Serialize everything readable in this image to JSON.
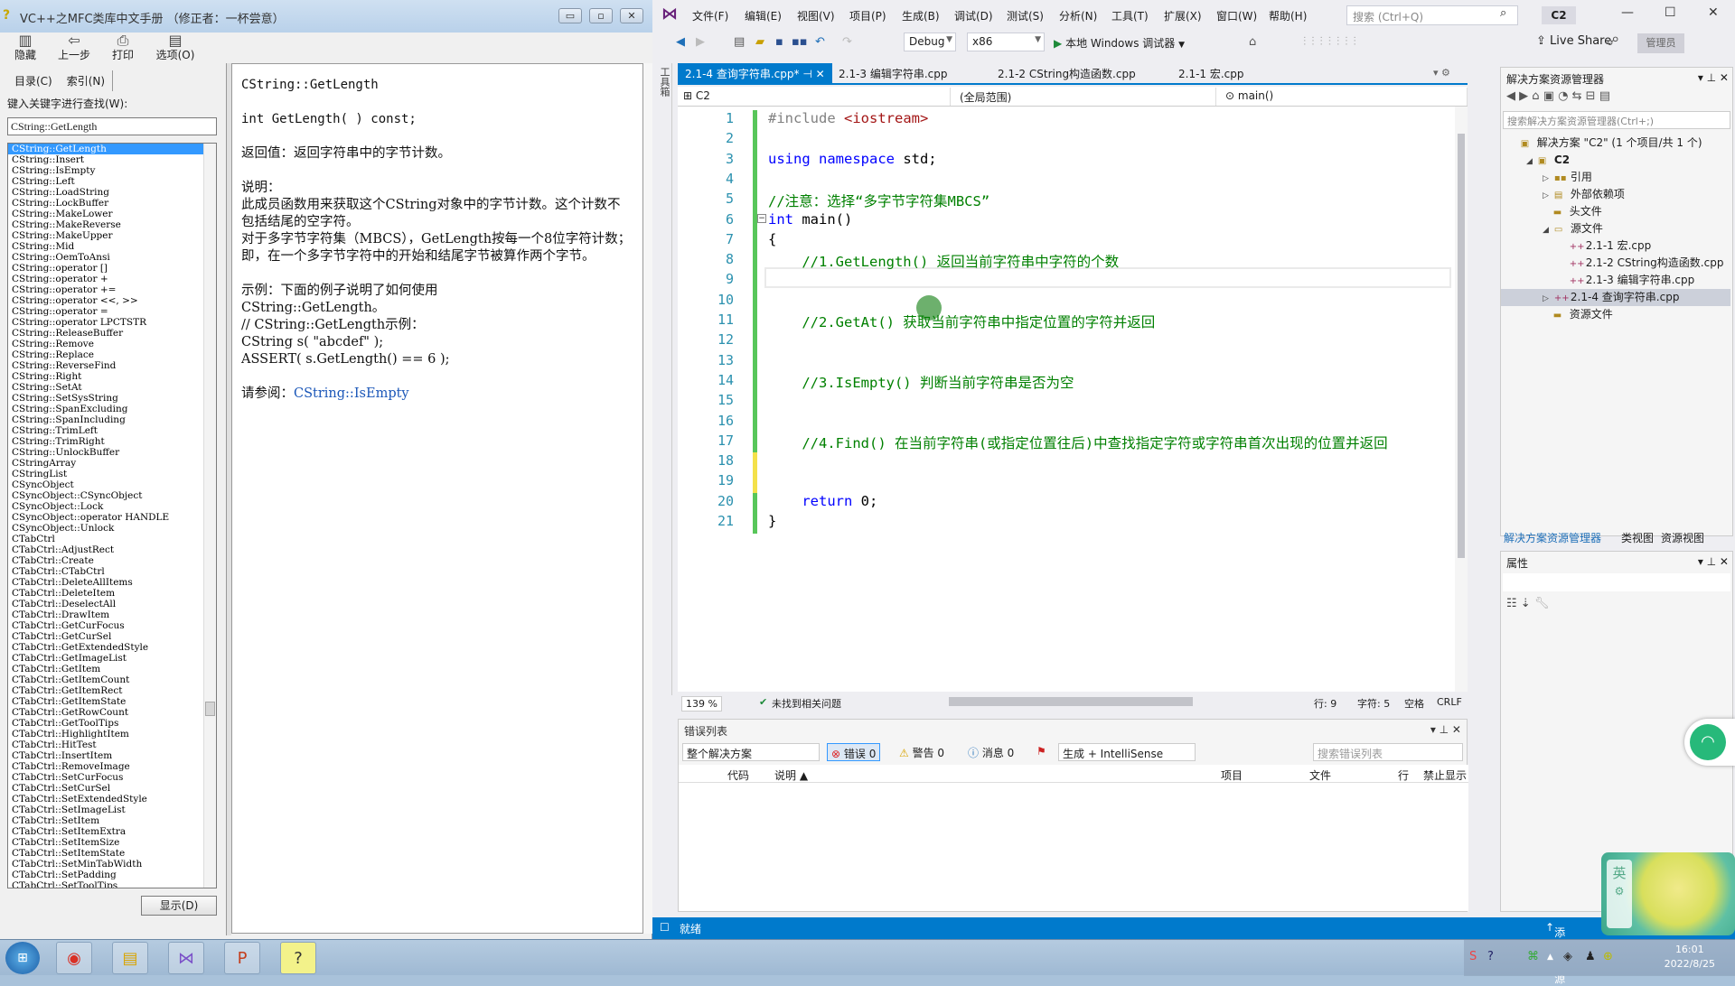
{
  "help_window": {
    "title": "VC++之MFC类库中文手册 （修正者：一杯尝意）",
    "window_controls": {
      "minimize": "▭",
      "restore": "▫",
      "close": "✕"
    },
    "toolbar": [
      {
        "icon": "hide-icon",
        "glyph": "▥",
        "label": "隐藏"
      },
      {
        "icon": "back-arrow-icon",
        "glyph": "⇦",
        "label": "上一步"
      },
      {
        "icon": "print-icon",
        "glyph": "⎙",
        "label": "打印"
      },
      {
        "icon": "options-icon",
        "glyph": "▤",
        "label": "选项(O)"
      }
    ],
    "tabs": [
      {
        "label": "目录(C)"
      },
      {
        "label": "索引(N)"
      }
    ],
    "keyword_label": "键入关键字进行查找(W):",
    "keyword_value": "CString::GetLength",
    "index_items": [
      "CString::GetLength",
      "CString::Insert",
      "CString::IsEmpty",
      "CString::Left",
      "CString::LoadString",
      "CString::LockBuffer",
      "CString::MakeLower",
      "CString::MakeReverse",
      "CString::MakeUpper",
      "CString::Mid",
      "CString::OemToAnsi",
      "CString::operator []",
      "CString::operator +",
      "CString::operator +=",
      "CString::operator <<, >>",
      "CString::operator =",
      "CString::operator LPCTSTR",
      "CString::ReleaseBuffer",
      "CString::Remove",
      "CString::Replace",
      "CString::ReverseFind",
      "CString::Right",
      "CString::SetAt",
      "CString::SetSysString",
      "CString::SpanExcluding",
      "CString::SpanIncluding",
      "CString::TrimLeft",
      "CString::TrimRight",
      "CString::UnlockBuffer",
      "CStringArray",
      "CStringList",
      "CSyncObject",
      "CSyncObject::CSyncObject",
      "CSyncObject::Lock",
      "CSyncObject::operator HANDLE",
      "CSyncObject::Unlock",
      "CTabCtrl",
      "CTabCtrl::AdjustRect",
      "CTabCtrl::Create",
      "CTabCtrl::CTabCtrl",
      "CTabCtrl::DeleteAllItems",
      "CTabCtrl::DeleteItem",
      "CTabCtrl::DeselectAll",
      "CTabCtrl::DrawItem",
      "CTabCtrl::GetCurFocus",
      "CTabCtrl::GetCurSel",
      "CTabCtrl::GetExtendedStyle",
      "CTabCtrl::GetImageList",
      "CTabCtrl::GetItem",
      "CTabCtrl::GetItemCount",
      "CTabCtrl::GetItemRect",
      "CTabCtrl::GetItemState",
      "CTabCtrl::GetRowCount",
      "CTabCtrl::GetToolTips",
      "CTabCtrl::HighlightItem",
      "CTabCtrl::HitTest",
      "CTabCtrl::InsertItem",
      "CTabCtrl::RemoveImage",
      "CTabCtrl::SetCurFocus",
      "CTabCtrl::SetCurSel",
      "CTabCtrl::SetExtendedStyle",
      "CTabCtrl::SetImageList",
      "CTabCtrl::SetItem",
      "CTabCtrl::SetItemExtra",
      "CTabCtrl::SetItemSize",
      "CTabCtrl::SetItemState",
      "CTabCtrl::SetMinTabWidth",
      "CTabCtrl::SetPadding",
      "CTabCtrl::SetToolTips"
    ],
    "selected_index": 0,
    "show_button": "显示(D)",
    "article": {
      "title": "CString::GetLength",
      "signature": "int GetLength( ) const;",
      "return_value": "返回值：返回字符串中的字节计数。",
      "remarks_heading": "说明：",
      "remarks_1": "此成员函数用来获取这个CString对象中的字节计数。这个计数不包括结尾的空字符。",
      "remarks_2": "对于多字节字符集（MBCS），GetLength按每一个8位字符计数；即，在一个多字节字符中的开始和结尾字节被算作两个字节。",
      "example_heading": "示例：下面的例子说明了如何使用",
      "example_1": "CString::GetLength。",
      "example_2": "// CString::GetLength示例：",
      "example_3": "CString s( \"abcdef\" );",
      "example_4": "ASSERT( s.GetLength() == 6 );",
      "see_also_label": "请参阅：",
      "see_also_link": "CString::IsEmpty"
    }
  },
  "vs": {
    "menu": [
      "文件(F)",
      "编辑(E)",
      "视图(V)",
      "项目(P)",
      "生成(B)",
      "调试(D)",
      "测试(S)",
      "分析(N)",
      "工具(T)",
      "扩展(X)",
      "窗口(W)",
      "帮助(H)"
    ],
    "search_placeholder": "搜索 (Ctrl+Q)",
    "project_badge": "C2",
    "toolbar": {
      "config": "Debug",
      "platform": "x86",
      "run_label": "本地 Windows 调试器",
      "live_share": "Live Share",
      "admin": "管理员"
    },
    "toolbox_label": "工具箱",
    "doc_tabs": [
      {
        "label": "2.1-4 查询字符串.cpp*",
        "active": true
      },
      {
        "label": "2.1-3 编辑字符串.cpp",
        "active": false
      },
      {
        "label": "2.1-2 CString构造函数.cpp",
        "active": false
      },
      {
        "label": "2.1-1 宏.cpp",
        "active": false
      }
    ],
    "nav": {
      "project": "C2",
      "scope": "(全局范围)",
      "member": "main()"
    },
    "code_lines": [
      {
        "n": "1",
        "html": "<span class='pp'>#include</span> <span class='st'>&lt;iostream&gt;</span>"
      },
      {
        "n": "2",
        "html": ""
      },
      {
        "n": "3",
        "html": "<span class='kw'>using namespace</span> std;"
      },
      {
        "n": "4",
        "html": ""
      },
      {
        "n": "5",
        "html": "<span class='cm'>//注意：选择“多字节字符集MBCS”</span>"
      },
      {
        "n": "6",
        "html": "<span class='kw'>int</span> main()"
      },
      {
        "n": "7",
        "html": "{"
      },
      {
        "n": "8",
        "html": "    <span class='cm'>//1.GetLength()  返回当前字符串中字符的个数</span>"
      },
      {
        "n": "9",
        "html": ""
      },
      {
        "n": "10",
        "html": ""
      },
      {
        "n": "11",
        "html": "    <span class='cm'>//2.GetAt()  获取当前字符串中指定位置的字符并返回</span>"
      },
      {
        "n": "12",
        "html": ""
      },
      {
        "n": "13",
        "html": ""
      },
      {
        "n": "14",
        "html": "    <span class='cm'>//3.IsEmpty()  判断当前字符串是否为空</span>"
      },
      {
        "n": "15",
        "html": ""
      },
      {
        "n": "16",
        "html": ""
      },
      {
        "n": "17",
        "html": "    <span class='cm'>//4.Find()  在当前字符串(或指定位置往后)中查找指定字符或字符串首次出现的位置并返回</span>"
      },
      {
        "n": "18",
        "html": ""
      },
      {
        "n": "19",
        "html": ""
      },
      {
        "n": "20",
        "html": "    <span class='kw'>return</span> 0;"
      },
      {
        "n": "21",
        "html": "}"
      }
    ],
    "editor_status": {
      "zoom": "139 %",
      "issues": "未找到相关问题",
      "line": "行: 9",
      "col": "字符: 5",
      "spaces": "空格",
      "eol": "CRLF"
    },
    "error_list": {
      "title": "错误列表",
      "scope": "整个解决方案",
      "errors": "错误 0",
      "warnings": "警告 0",
      "messages": "消息 0",
      "source": "生成 + IntelliSense",
      "search_placeholder": "搜索错误列表",
      "columns": [
        "代码",
        "说明 ▲",
        "项目",
        "文件",
        "行",
        "禁止显示"
      ]
    },
    "solution_explorer": {
      "title": "解决方案资源管理器",
      "search_placeholder": "搜索解决方案资源管理器(Ctrl+;)",
      "tree": [
        {
          "label": "解决方案 \"C2\" (1 个项目/共 1 个)",
          "depth": 0,
          "tri": "",
          "icon": "▣"
        },
        {
          "label": "C2",
          "depth": 1,
          "tri": "◢",
          "icon": "▣",
          "bold": true
        },
        {
          "label": "引用",
          "depth": 2,
          "tri": "▷",
          "icon": "▪▪"
        },
        {
          "label": "外部依赖项",
          "depth": 2,
          "tri": "▷",
          "icon": "▤"
        },
        {
          "label": "头文件",
          "depth": 2,
          "tri": "",
          "icon": "▬"
        },
        {
          "label": "源文件",
          "depth": 2,
          "tri": "◢",
          "icon": "▭"
        },
        {
          "label": "2.1-1 宏.cpp",
          "depth": 3,
          "tri": "",
          "icon": "++"
        },
        {
          "label": "2.1-2 CString构造函数.cpp",
          "depth": 3,
          "tri": "",
          "icon": "++"
        },
        {
          "label": "2.1-3 编辑字符串.cpp",
          "depth": 3,
          "tri": "",
          "icon": "++"
        },
        {
          "label": "2.1-4 查询字符串.cpp",
          "depth": 3,
          "tri": "▷",
          "icon": "++",
          "selected": true
        },
        {
          "label": "资源文件",
          "depth": 2,
          "tri": "",
          "icon": "▬"
        }
      ],
      "bottom_tabs": [
        "解决方案资源管理器",
        "类视图",
        "资源视图"
      ]
    },
    "properties": {
      "title": "属性"
    },
    "status": {
      "ready": "就绪",
      "add_source": "添加到源"
    }
  },
  "widgets": {
    "ime_label": "英"
  },
  "taskbar": {
    "apps": [
      {
        "name": "chrome",
        "glyph": "◉"
      },
      {
        "name": "explorer",
        "glyph": "▤"
      },
      {
        "name": "visual-studio",
        "glyph": "⋈"
      },
      {
        "name": "powerpoint",
        "glyph": "P"
      },
      {
        "name": "help-manual",
        "glyph": "?"
      }
    ],
    "time": "16:01",
    "date": "2022/8/25"
  },
  "colors": {
    "accent": "#007acc",
    "selection": "#3399ff",
    "comment": "#008000",
    "keyword": "#0000ff",
    "line_number": "#2b91af"
  }
}
